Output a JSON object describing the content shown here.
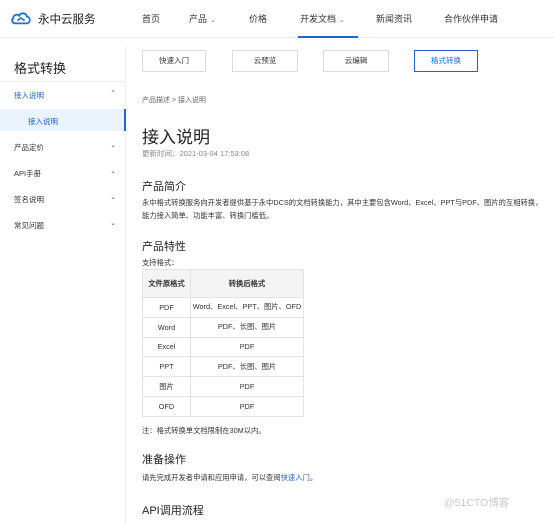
{
  "brand": {
    "name": "永中云服务",
    "colors": {
      "accent": "#1e64d8",
      "logo": "#1f6fd6"
    }
  },
  "topnav": {
    "items": [
      {
        "label": "首页",
        "has_dropdown": false
      },
      {
        "label": "产品",
        "has_dropdown": true
      },
      {
        "label": "价格",
        "has_dropdown": false
      },
      {
        "label": "开发文档",
        "has_dropdown": true,
        "active": true
      },
      {
        "label": "新闻资讯",
        "has_dropdown": false
      },
      {
        "label": "合作伙伴申请",
        "has_dropdown": false
      }
    ]
  },
  "sidebar": {
    "title": "格式转换",
    "items": [
      {
        "label": "接入说明",
        "expanded": true,
        "icon": "chevron-up-icon"
      },
      {
        "label": "产品定价",
        "icon": "chevron-down-icon"
      },
      {
        "label": "API手册",
        "icon": "chevron-down-icon"
      },
      {
        "label": "签名说明",
        "icon": "chevron-down-icon"
      },
      {
        "label": "常见问题",
        "icon": "chevron-down-icon"
      }
    ],
    "subitem": {
      "label": "接入说明",
      "selected": true
    }
  },
  "tabs": [
    {
      "label": "快速入门"
    },
    {
      "label": "云预览"
    },
    {
      "label": "云编辑"
    },
    {
      "label": "格式转换",
      "active": true
    }
  ],
  "breadcrumb": "产品描述 > 接入说明",
  "page": {
    "title": "接入说明",
    "updated": "更新时间：2021-03-04 17:53:08"
  },
  "sections": {
    "intro": {
      "heading": "产品简介",
      "text": "永中格式转换服务向开发者提供基于永中DCS的文档转换能力，其中主要包含Word、Excel、PPT与PDF、图片的互相转换，能力接入简单、功能丰富、转换门槛低。"
    },
    "features": {
      "heading": "产品特性",
      "support_label": "支持格式：",
      "table": {
        "headers": [
          "文件原格式",
          "转换后格式"
        ],
        "rows": [
          [
            "PDF",
            "Word、Excel、PPT、图片、OFD"
          ],
          [
            "Word",
            "PDF、长图、图片"
          ],
          [
            "Excel",
            "PDF"
          ],
          [
            "PPT",
            "PDF、长图、图片"
          ],
          [
            "图片",
            "PDF"
          ],
          [
            "OFD",
            "PDF"
          ]
        ]
      },
      "note": "注：格式转换单文档限制在30M以内。"
    },
    "prep": {
      "heading": "准备操作",
      "text_prefix": "请先完成开发者申请和应用申请，可以查阅",
      "link": "快速入门",
      "text_suffix": "。"
    },
    "flow": {
      "heading": "API调用流程"
    }
  },
  "watermark": "@51CTO博客"
}
